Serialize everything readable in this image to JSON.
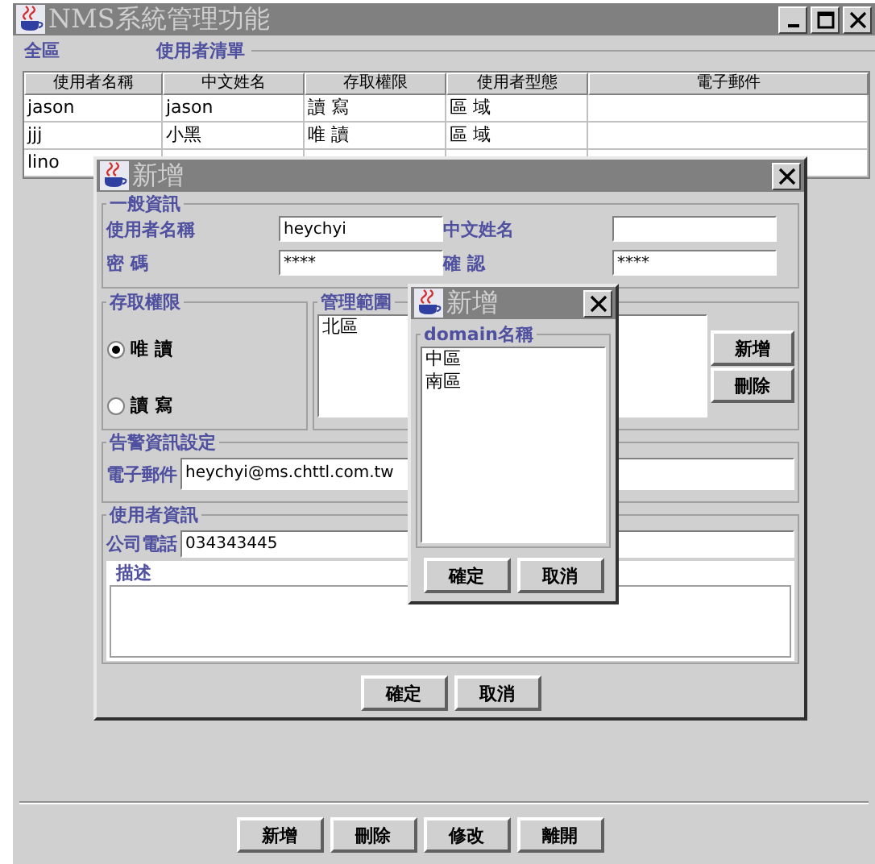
{
  "window": {
    "title": "NMS系統管理功能"
  },
  "tree_panel": {
    "title": "全區"
  },
  "user_list": {
    "title": "使用者清單",
    "columns": [
      "使用者名稱",
      "中文姓名",
      "存取權限",
      "使用者型態",
      "電子郵件"
    ],
    "rows": [
      {
        "cells": [
          "jason",
          "jason",
          "讀 寫",
          "區 域"
        ]
      },
      {
        "cells": [
          "jjj",
          "小黑",
          "唯 讀",
          "區 域"
        ]
      },
      {
        "cells": [
          "lino"
        ]
      }
    ]
  },
  "buttons": [
    "新增",
    "刪除",
    "修改",
    "離開"
  ],
  "add_dialog": {
    "title": "新增",
    "general": {
      "title": "一般資訊",
      "fields": [
        {
          "label": "使用者名稱",
          "value": "heychyi"
        },
        {
          "label": "中文姓名"
        },
        {
          "label": "密 碼",
          "value": "****"
        },
        {
          "label": "確 認",
          "value": "****"
        }
      ]
    },
    "access": {
      "title": "存取權限",
      "options": [
        {
          "label": "唯 讀",
          "selected": true
        },
        {
          "label": "讀 寫",
          "selected": false
        }
      ]
    },
    "scope": {
      "title": "管理範圍",
      "items": [
        "北區"
      ],
      "buttons": [
        "新增",
        "刪除"
      ]
    },
    "alarm": {
      "title": "告警資訊設定",
      "fields": [
        {
          "label": "電子郵件",
          "value": "heychyi@ms.chttl.com.tw"
        }
      ]
    },
    "user_info": {
      "title": "使用者資訊",
      "fields": [
        {
          "label": "公司電話",
          "value": "034343445"
        }
      ],
      "description": {
        "title": "描述"
      }
    },
    "buttons": [
      "確定",
      "取消"
    ]
  },
  "domain_dialog": {
    "title": "新增",
    "group_title": "domain名稱",
    "items": [
      "中區",
      "南區"
    ],
    "buttons": [
      "確定",
      "取消"
    ]
  }
}
